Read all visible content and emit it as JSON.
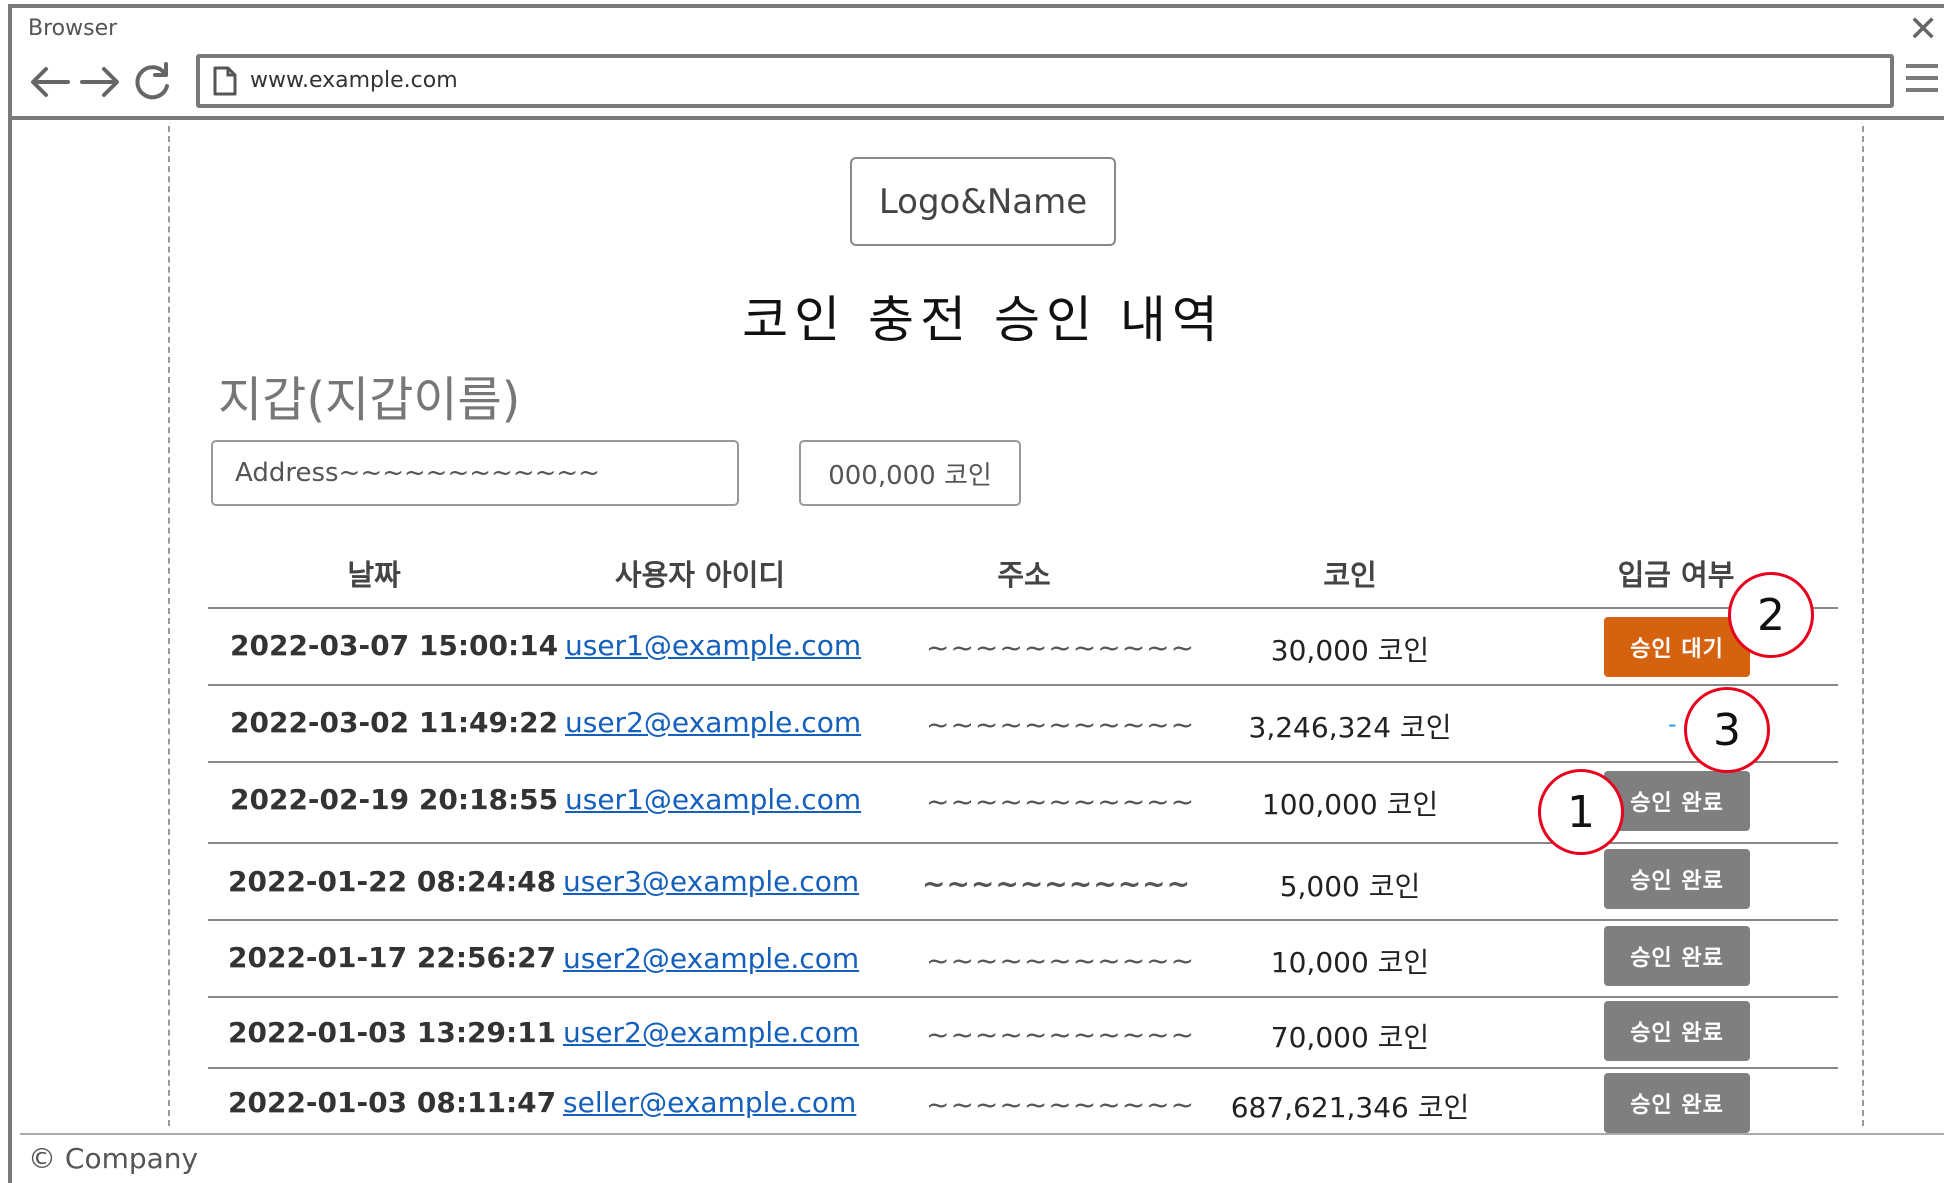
{
  "browser": {
    "label": "Browser",
    "url": "www.example.com",
    "icons": [
      "back-arrow-icon",
      "forward-arrow-icon",
      "reload-icon",
      "document-icon",
      "menu-icon",
      "close-icon"
    ]
  },
  "header": {
    "logo": "Logo&Name",
    "title": "코인 충전 승인 내역"
  },
  "wallet": {
    "title": "지갑(지갑이름)",
    "address": "Address~~~~~~~~~~~~",
    "balance": "000,000 코인"
  },
  "table": {
    "columns": [
      "날짜",
      "사용자 아이디",
      "주소",
      "코인",
      "입금 여부"
    ],
    "rows": [
      {
        "date": "2022-03-07 15:00:14",
        "user": "user1@example.com",
        "address": "~~~~~~~~~~~",
        "coin": "30,000 코인",
        "status": "승인 대기",
        "status_type": "pending"
      },
      {
        "date": "2022-03-02 11:49:22",
        "user": "user2@example.com",
        "address": "~~~~~~~~~~~",
        "coin": "3,246,324 코인",
        "status": "-",
        "status_type": "none"
      },
      {
        "date": "2022-02-19 20:18:55",
        "user": "user1@example.com",
        "address": "~~~~~~~~~~~",
        "coin": "100,000 코인",
        "status": "승인 완료",
        "status_type": "done"
      },
      {
        "date": "2022-01-22 08:24:48",
        "user": "user3@example.com",
        "address": "~~~~~~~~~~~",
        "coin": "5,000 코인",
        "status": "승인 완료",
        "status_type": "done"
      },
      {
        "date": "2022-01-17 22:56:27",
        "user": "user2@example.com",
        "address": "~~~~~~~~~~~",
        "coin": "10,000 코인",
        "status": "승인 완료",
        "status_type": "done"
      },
      {
        "date": "2022-01-03 13:29:11",
        "user": "user2@example.com",
        "address": "~~~~~~~~~~~",
        "coin": "70,000 코인",
        "status": "승인 완료",
        "status_type": "done"
      },
      {
        "date": "2022-01-03 08:11:47",
        "user": "seller@example.com",
        "address": "~~~~~~~~~~~",
        "coin": "687,621,346 코인",
        "status": "승인 완료",
        "status_type": "done"
      }
    ]
  },
  "markers": [
    "1",
    "2",
    "3"
  ],
  "colors": {
    "pending": "#d4620f",
    "done": "#7f7f7f",
    "link": "#1560bd",
    "marker": "#e8001c"
  },
  "footer": "© Company"
}
